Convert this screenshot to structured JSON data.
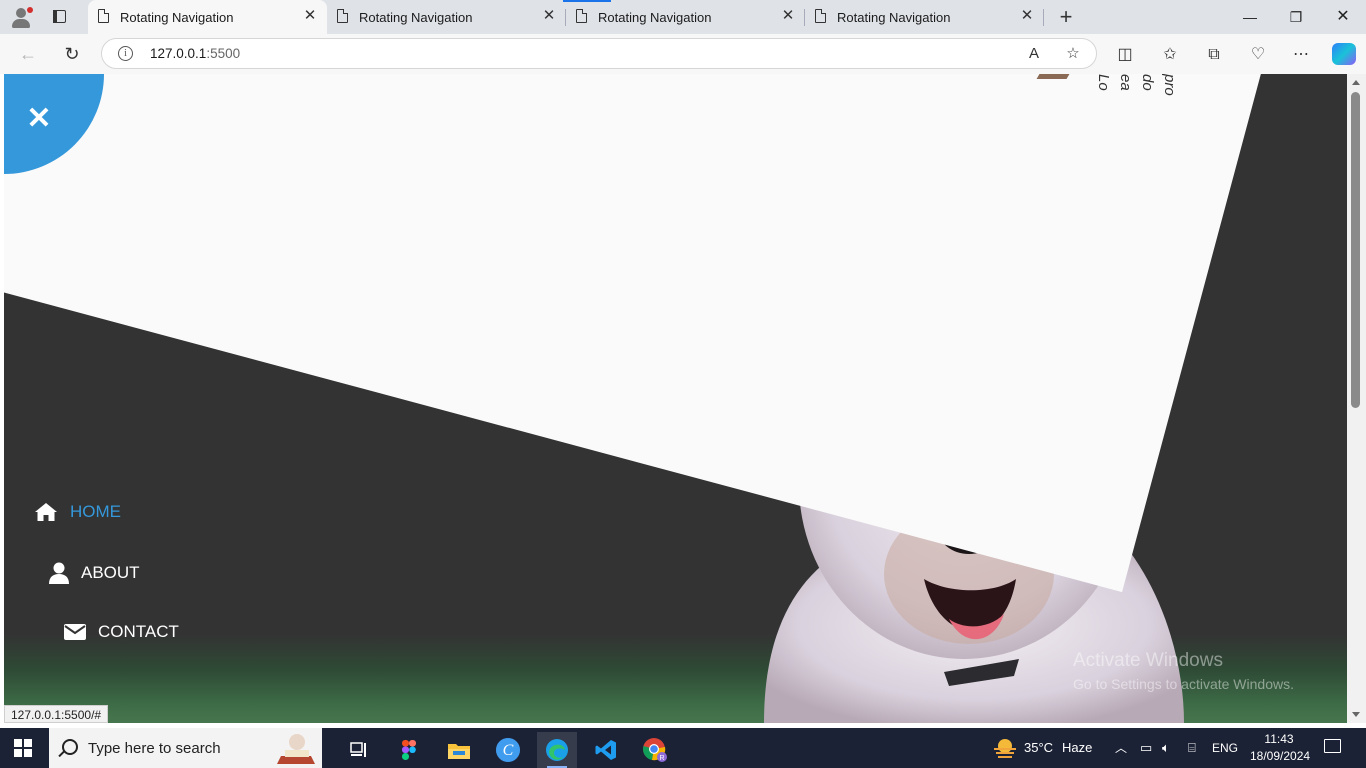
{
  "browser": {
    "tabs": [
      {
        "title": "Rotating Navigation",
        "active": true
      },
      {
        "title": "Rotating Navigation",
        "active": false
      },
      {
        "title": "Rotating Navigation",
        "active": false
      },
      {
        "title": "Rotating Navigation",
        "active": false
      }
    ],
    "address": {
      "host": "127.0.0.1",
      "port": ":5500"
    },
    "status_url": "127.0.0.1:5500/#",
    "icons": {
      "profile": "profile-icon",
      "tab_actions": "tab-actions-icon",
      "new_tab": "plus-icon",
      "minimize": "minimize-icon",
      "restore": "restore-icon",
      "close": "close-icon",
      "back": "back-arrow-icon",
      "refresh": "refresh-icon",
      "read_aloud": "read-aloud-icon",
      "favorite": "star-icon",
      "split": "split-screen-icon",
      "favorites": "favorites-icon",
      "collections": "collections-icon",
      "browser_essentials": "heart-pulse-icon",
      "more": "more-icon",
      "copilot": "copilot-icon"
    }
  },
  "page": {
    "menu": [
      {
        "label": "Home",
        "icon": "home-icon",
        "active": true
      },
      {
        "label": "About",
        "icon": "user-icon",
        "active": false
      },
      {
        "label": "Contact",
        "icon": "envelope-icon",
        "active": false
      }
    ],
    "rotated_text": "Lo ea do pro",
    "colors": {
      "accent": "#3498db",
      "background": "#333333",
      "page": "#fafafa"
    }
  },
  "watermark": {
    "line1": "Activate Windows",
    "line2": "Go to Settings to activate Windows."
  },
  "taskbar": {
    "search_placeholder": "Type here to search",
    "apps": [
      "task-view-icon",
      "figma-icon",
      "file-explorer-icon",
      "canva-icon",
      "edge-icon",
      "vscode-icon",
      "chrome-icon"
    ],
    "weather": {
      "temp": "35°C",
      "condition": "Haze"
    },
    "language": "ENG",
    "time": "11:43",
    "date": "18/09/2024"
  }
}
